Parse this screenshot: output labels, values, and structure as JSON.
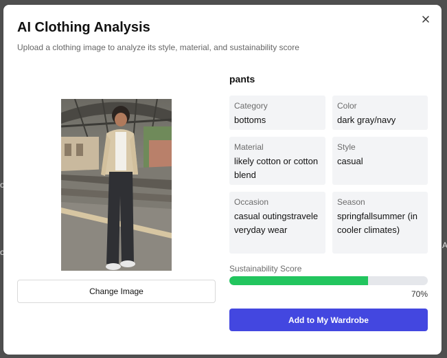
{
  "background_fragments": [
    "o",
    "o",
    "A"
  ],
  "modal": {
    "title": "AI Clothing Analysis",
    "subtitle": "Upload a clothing image to analyze its style, material, and sustainability score",
    "close_icon": "close-icon",
    "image": {
      "description_icon": "uploaded-clothing-photo",
      "change_button_label": "Change Image"
    },
    "result": {
      "item_name": "pants",
      "attributes": [
        {
          "label": "Category",
          "value": "bottoms"
        },
        {
          "label": "Color",
          "value": "dark gray/navy"
        },
        {
          "label": "Material",
          "value": "likely cotton or cotton blend"
        },
        {
          "label": "Style",
          "value": "casual"
        },
        {
          "label": "Occasion",
          "value": "casual outingstraveleveryday wear"
        },
        {
          "label": "Season",
          "value": "springfallsummer (in cooler climates)"
        }
      ],
      "sustainability": {
        "label": "Sustainability Score",
        "score": 70,
        "score_text": "70%"
      },
      "add_button_label": "Add to My Wardrobe"
    }
  },
  "colors": {
    "primary": "#4347e0",
    "progress": "#22c55e",
    "card_bg": "#f3f4f6"
  }
}
